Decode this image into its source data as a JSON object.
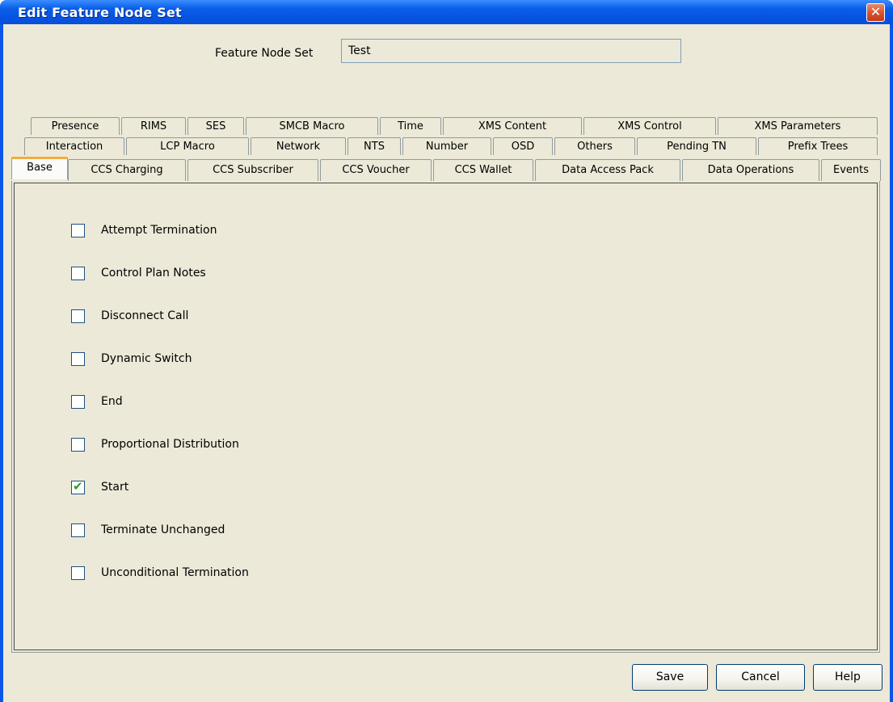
{
  "window": {
    "title": "Edit Feature Node Set",
    "close_glyph": "✕"
  },
  "feature_node_set": {
    "label": "Feature Node Set",
    "value": "Test"
  },
  "tabs": {
    "row1": [
      "Presence",
      "RIMS",
      "SES",
      "SMCB Macro",
      "Time",
      "XMS Content",
      "XMS Control",
      "XMS Parameters"
    ],
    "row2": [
      "Interaction",
      "LCP Macro",
      "Network",
      "NTS",
      "Number",
      "OSD",
      "Others",
      "Pending TN",
      "Prefix Trees"
    ],
    "row3": [
      "Base",
      "CCS Charging",
      "CCS Subscriber",
      "CCS Voucher",
      "CCS Wallet",
      "Data Access Pack",
      "Data Operations",
      "Events"
    ],
    "selected": "Base"
  },
  "checkboxes": [
    {
      "label": "Attempt Termination",
      "checked": false
    },
    {
      "label": "Control Plan Notes",
      "checked": false
    },
    {
      "label": "Disconnect Call",
      "checked": false
    },
    {
      "label": "Dynamic Switch",
      "checked": false
    },
    {
      "label": "End",
      "checked": false
    },
    {
      "label": "Proportional Distribution",
      "checked": false
    },
    {
      "label": "Start",
      "checked": true
    },
    {
      "label": "Terminate Unchanged",
      "checked": false
    },
    {
      "label": "Unconditional Termination",
      "checked": false
    }
  ],
  "buttons": {
    "save": "Save",
    "cancel": "Cancel",
    "help": "Help"
  },
  "colors": {
    "titlebar": "#0a5fe8",
    "dialog_bg": "#ece9d8",
    "selected_tab_accent": "#f6ab3f",
    "check": "#21a121"
  }
}
